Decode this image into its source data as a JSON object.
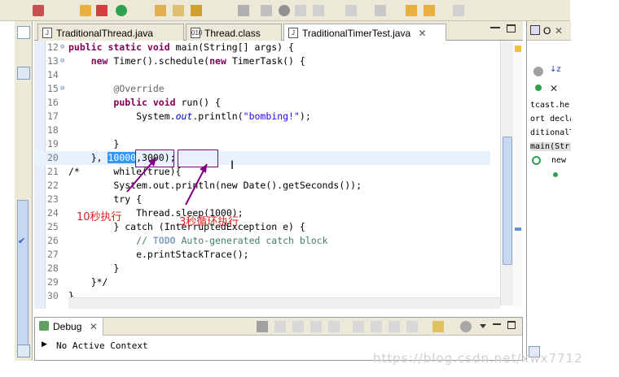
{
  "editor_tabs": [
    {
      "label": "TraditionalThread.java",
      "icon": "java-file-icon"
    },
    {
      "label": "Thread.class",
      "icon": "class-file-icon"
    },
    {
      "label": "TraditionalTimerTest.java",
      "icon": "java-file-icon",
      "close": "✕"
    }
  ],
  "code_lines": [
    {
      "num": "12",
      "fold": "⊖",
      "parts": [
        [
          "kw",
          "public static void"
        ],
        [
          "t",
          " main(String[] args) {"
        ]
      ]
    },
    {
      "num": "13",
      "fold": "⊖",
      "parts": [
        [
          "t",
          "    "
        ],
        [
          "kw",
          "new"
        ],
        [
          "t",
          " Timer().schedule("
        ],
        [
          "kw",
          "new"
        ],
        [
          "t",
          " TimerTask() {"
        ]
      ]
    },
    {
      "num": "14",
      "fold": "",
      "parts": []
    },
    {
      "num": "15",
      "fold": "⊖",
      "parts": [
        [
          "t",
          "        "
        ],
        [
          "ann",
          "@Override"
        ]
      ]
    },
    {
      "num": "16",
      "fold": "",
      "parts": [
        [
          "t",
          "        "
        ],
        [
          "kw",
          "public void"
        ],
        [
          "t",
          " run() {"
        ]
      ]
    },
    {
      "num": "17",
      "fold": "",
      "parts": [
        [
          "t",
          "            System."
        ],
        [
          "static",
          "out"
        ],
        [
          "t",
          ".println("
        ],
        [
          "str",
          "\"bombing!\""
        ],
        [
          "t",
          ");"
        ]
      ]
    },
    {
      "num": "18",
      "fold": "",
      "parts": []
    },
    {
      "num": "19",
      "fold": "",
      "parts": [
        [
          "t",
          "        }"
        ]
      ]
    },
    {
      "num": "20",
      "fold": "",
      "parts": [
        [
          "t",
          "    }, "
        ],
        [
          "sel",
          "10000"
        ],
        [
          "t",
          ",3000);"
        ]
      ]
    },
    {
      "num": "21",
      "fold": "",
      "parts": [
        [
          "t",
          "/*      while(true){"
        ]
      ]
    },
    {
      "num": "22",
      "fold": "",
      "parts": [
        [
          "t",
          "        System.out.println(new Date().getSeconds());"
        ]
      ]
    },
    {
      "num": "23",
      "fold": "",
      "parts": [
        [
          "t",
          "        try {"
        ]
      ]
    },
    {
      "num": "24",
      "fold": "",
      "parts": [
        [
          "t",
          "            Thread.sleep(1000);"
        ]
      ]
    },
    {
      "num": "25",
      "fold": "",
      "parts": [
        [
          "t",
          "        } catch (InterruptedException e) {"
        ]
      ]
    },
    {
      "num": "26",
      "fold": "",
      "parts": [
        [
          "t",
          "            "
        ],
        [
          "com",
          "// "
        ],
        [
          "todo",
          "TODO"
        ],
        [
          "com",
          " Auto-generated catch block"
        ]
      ]
    },
    {
      "num": "27",
      "fold": "",
      "parts": [
        [
          "t",
          "            e.printStackTrace();"
        ]
      ]
    },
    {
      "num": "28",
      "fold": "",
      "parts": [
        [
          "t",
          "        }"
        ]
      ]
    },
    {
      "num": "29",
      "fold": "",
      "parts": [
        [
          "t",
          "    }*/"
        ]
      ]
    },
    {
      "num": "30",
      "fold": "",
      "parts": [
        [
          "t",
          "}"
        ]
      ]
    }
  ],
  "annotations": {
    "note_10s": "10秒执行",
    "note_3s": "3秒循环执行",
    "arrow_color": "#800080",
    "note_color": "#e02020"
  },
  "debug": {
    "tab_label": "Debug",
    "close": "✕",
    "status": "No Active Context",
    "expand": "▶"
  },
  "outline": {
    "tab_label": "O",
    "close": "✕",
    "items": [
      "tcast.he",
      "ort decla",
      "ditionalT",
      "main(Str",
      "new"
    ]
  },
  "watermark": "https://blog.csdn.net/xwx7712",
  "colors": {
    "keyword": "#7f0055",
    "string": "#2a00ff",
    "comment": "#3f7f5f",
    "selection": "#3399ff",
    "chrome": "#ece9d8"
  }
}
